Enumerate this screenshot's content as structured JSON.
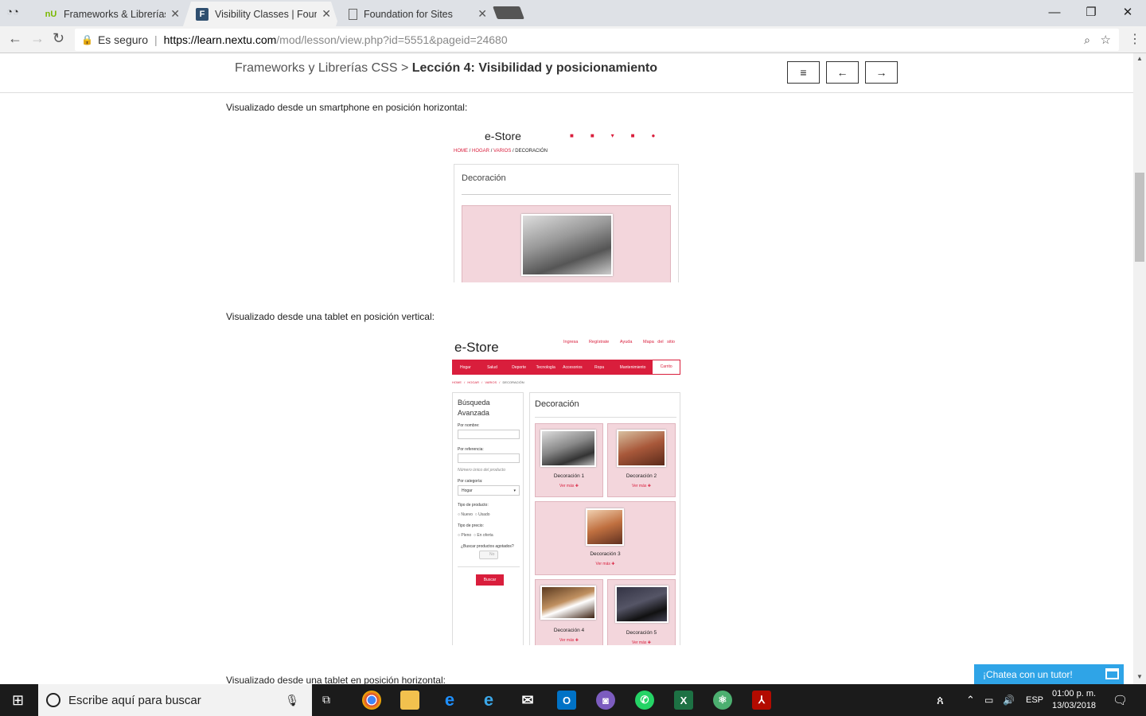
{
  "browser": {
    "tabs": [
      {
        "title": "Frameworks & Librerías C",
        "favicon": "nU"
      },
      {
        "title": "Visibility Classes | Found",
        "favicon": "F"
      },
      {
        "title": "Foundation for Sites",
        "favicon": "doc"
      }
    ],
    "secure_label": "Es seguro",
    "url_host": "https://learn.nextu.com",
    "url_path": "/mod/lesson/view.php?id=5551&pageid=24680"
  },
  "lesson": {
    "course": "Frameworks y Librerías CSS",
    "separator": ">",
    "title": "Lección 4: Visibilidad y posicionamiento",
    "menu_btn": "≡",
    "prev_btn": "←",
    "next_btn": "→"
  },
  "captions": {
    "smartphone": "Visualizado desde un smartphone en posición horizontal:",
    "tablet_v": "Visualizado desde una tablet en posición vertical:",
    "tablet_h": "Visualizado desde una tablet en posición horizontal:"
  },
  "phone_shot": {
    "logo": "e-Store",
    "crumbs": [
      "HOME",
      "HOGAR",
      "VARIOS",
      "DECORACIÓN"
    ],
    "heading": "Decoración"
  },
  "tablet_shot": {
    "logo": "e-Store",
    "toplinks": [
      "Ingresa",
      "Regístrate",
      "Ayuda",
      "Mapa del sitio"
    ],
    "nav": [
      "Hogar",
      "Salud",
      "Deporte",
      "Tecnología",
      "Accesorios",
      "Ropa",
      "Mantenimiento"
    ],
    "cart": "Carrito",
    "crumbs": [
      "HOME",
      "HOGAR",
      "VARIOS",
      "DECORACIÓN"
    ],
    "search_title": "Búsqueda Avanzada",
    "by_name": "Por nombre:",
    "by_ref": "Por referencia:",
    "ref_hint": "Número único del producto",
    "by_cat": "Por categoría:",
    "cat_value": "Hogar",
    "type_label": "Tipo de producto:",
    "type_new": "Nuevo",
    "type_used": "Usado",
    "price_label": "Tipo de precio:",
    "price_full": "Pleno",
    "price_offer": "En oferta",
    "sold_out": "¿Buscar productos agotados?",
    "toggle": "No",
    "search_btn": "Buscar",
    "heading": "Decoración",
    "items": [
      "Decoración 1",
      "Decoración 2",
      "Decoración 3",
      "Decoración 4",
      "Decoración 5"
    ],
    "more": "Ver más"
  },
  "chat": {
    "label": "¡Chatea con un tutor!"
  },
  "taskbar": {
    "search_placeholder": "Escribe aquí para buscar",
    "lang": "ESP",
    "time": "01:00 p. m.",
    "date": "13/03/2018"
  }
}
